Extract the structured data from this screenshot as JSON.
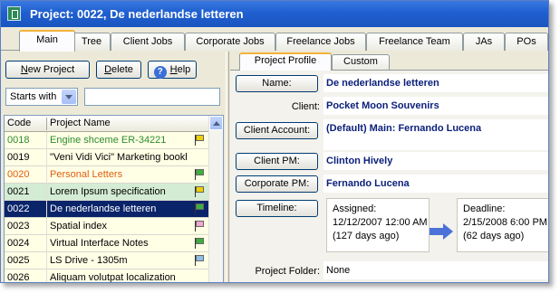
{
  "window": {
    "title": "Project: 0022, De nederlandse letteren",
    "app_icon": "app-logo-icon"
  },
  "tabs": [
    "Main",
    "Tree",
    "Client Jobs",
    "Corporate Jobs",
    "Freelance Jobs",
    "Freelance Team",
    "JAs",
    "POs"
  ],
  "active_tab": "Main",
  "left": {
    "buttons": {
      "new_project": "New Project",
      "new_project_hotkey": "N",
      "delete": "Delete",
      "delete_hotkey": "D",
      "help": "Help",
      "help_hotkey": "H"
    },
    "filter": {
      "mode": "Starts with",
      "search_value": ""
    },
    "grid": {
      "columns": [
        "Code",
        "Project Name"
      ],
      "rows": [
        {
          "code": "0018",
          "name": "Engine shceme ER-34221",
          "text_color": "#2e8b2e",
          "row_style": "yellow",
          "flag": "#f0d000"
        },
        {
          "code": "0019",
          "name": "\"Veni Vidi Vici\" Marketing bookl",
          "text_color": "#000000",
          "row_style": "yellow",
          "flag": ""
        },
        {
          "code": "0020",
          "name": "Personal Letters",
          "text_color": "#e06010",
          "row_style": "yellow",
          "flag": "#3cb03c"
        },
        {
          "code": "0021",
          "name": "Lorem Ipsum specification",
          "text_color": "#000000",
          "row_style": "green",
          "flag": "#f0d000"
        },
        {
          "code": "0022",
          "name": "De nederlandse letteren",
          "text_color": "#ffffff",
          "row_style": "selected",
          "flag": "#3cb03c"
        },
        {
          "code": "0023",
          "name": "Spatial index",
          "text_color": "#000000",
          "row_style": "yellow",
          "flag": "#f2a6d0"
        },
        {
          "code": "0024",
          "name": "Virtual Interface Notes",
          "text_color": "#000000",
          "row_style": "yellow",
          "flag": "#3cb03c"
        },
        {
          "code": "0025",
          "name": "LS Drive - 1305m",
          "text_color": "#000000",
          "row_style": "yellow",
          "flag": "#8fbfe8"
        },
        {
          "code": "0026",
          "name": "Aliquam volutpat localization",
          "text_color": "#000000",
          "row_style": "yellow",
          "flag": ""
        }
      ]
    }
  },
  "right": {
    "subtabs": [
      "Project Profile",
      "Custom"
    ],
    "active_subtab": "Project Profile",
    "fields": {
      "name_label": "Name:",
      "name_value": "De nederlandse letteren",
      "client_label": "Client:",
      "client_value": "Pocket Moon Souvenirs",
      "client_account_label": "Client Account:",
      "client_account_value": "(Default) Main: Fernando Lucena",
      "client_pm_label": "Client PM:",
      "client_pm_value": "Clinton Hively",
      "corporate_pm_label": "Corporate PM:",
      "corporate_pm_value": "Fernando Lucena",
      "timeline_label": "Timeline:",
      "project_folder_label": "Project Folder:",
      "project_folder_value": "None"
    },
    "timeline": {
      "assigned_label": "Assigned:",
      "assigned_date": "12/12/2007 12:00 AM",
      "assigned_ago": "(127 days ago)",
      "deadline_label": "Deadline:",
      "deadline_date": "2/15/2008 6:00 PM",
      "deadline_ago": "(62 days ago)"
    }
  }
}
